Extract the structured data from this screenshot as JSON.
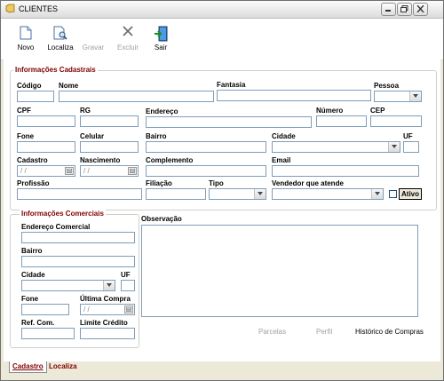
{
  "window": {
    "title": "CLIENTES"
  },
  "toolbar": {
    "novo": "Novo",
    "localiza": "Localiza",
    "gravar": "Gravar",
    "excluir": "Excluir",
    "sair": "Sair"
  },
  "cadastrais": {
    "legend": "Informações Cadastrais",
    "codigo": "Código",
    "nome": "Nome",
    "fantasia": "Fantasia",
    "pessoa": "Pessoa",
    "cpf": "CPF",
    "rg": "RG",
    "endereco": "Endereço",
    "numero": "Número",
    "cep": "CEP",
    "fone": "Fone",
    "celular": "Celular",
    "bairro": "Bairro",
    "cidade": "Cidade",
    "uf": "UF",
    "cadastro": "Cadastro",
    "cadastro_value": " / /",
    "nascimento": "Nascimento",
    "nascimento_value": " / /",
    "complemento": "Complemento",
    "email": "Email",
    "profissao": "Profissão",
    "filiacao": "Filiação",
    "tipo": "Tipo",
    "vendedor": "Vendedor que atende",
    "ativo": "Ativo"
  },
  "comerciais": {
    "legend": "Informações Comerciais",
    "endereco_comercial": "Endereço Comercial",
    "bairro": "Bairro",
    "cidade": "Cidade",
    "uf": "UF",
    "fone": "Fone",
    "ultima_compra": "Última Compra",
    "ultima_compra_value": " / /",
    "ref_com": "Ref. Com.",
    "limite_credito": "Limite Crédito",
    "observacao": "Observação"
  },
  "actions": {
    "parcelas": "Parcelas",
    "perfil": "Perfil",
    "historico": "Histórico de Compras"
  },
  "tabs": [
    "Cadastro",
    "Localiza"
  ],
  "colors": {
    "legend": "#800000",
    "input_border": "#7f9db9",
    "window_bg": "#ece9d8"
  }
}
